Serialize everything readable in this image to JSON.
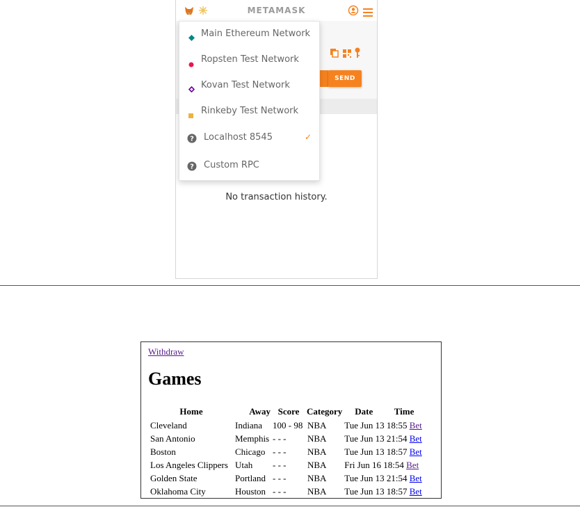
{
  "metamask": {
    "title": "METAMASK",
    "colors": {
      "accent": "#f6821f",
      "title": "#9b9b9b"
    },
    "send_label": "SEND",
    "empty_history": "No transaction history.",
    "networks": [
      {
        "label": "Main Ethereum Network",
        "icon": "diamond-icon",
        "color": "#038789",
        "selected": false
      },
      {
        "label": "Ropsten Test Network",
        "icon": "dot-icon",
        "color": "#e91550",
        "selected": false
      },
      {
        "label": "Kovan Test Network",
        "icon": "diamond-outline-icon",
        "color": "#690496",
        "selected": false
      },
      {
        "label": "Rinkeby Test Network",
        "icon": "square-icon",
        "color": "#ebb33f",
        "selected": false
      },
      {
        "label": "Localhost 8545",
        "icon": "question-circle-icon",
        "color": "#666666",
        "selected": true
      },
      {
        "label": "Custom RPC",
        "icon": "question-circle-icon",
        "color": "#666666",
        "selected": false
      }
    ],
    "check_mark": "✓"
  },
  "dapp": {
    "withdraw_label": "Withdraw",
    "title": "Games",
    "columns": [
      "Home",
      "Away",
      "Score",
      "Category",
      "Date",
      "Time"
    ],
    "rows": [
      {
        "home": "Cleveland",
        "away": "Indiana",
        "score": "100 - 98",
        "category": "NBA",
        "date": "Tue Jun 13",
        "time": "18:55",
        "action": "Bet"
      },
      {
        "home": "San Antonio",
        "away": "Memphis",
        "score": "- - -",
        "category": "NBA",
        "date": "Tue Jun 13",
        "time": "21:54",
        "action": "Bet"
      },
      {
        "home": "Boston",
        "away": "Chicago",
        "score": "- - -",
        "category": "NBA",
        "date": "Tue Jun 13",
        "time": "18:57",
        "action": "Bet"
      },
      {
        "home": "Los Angeles Clippers",
        "away": "Utah",
        "score": "- - -",
        "category": "NBA",
        "date": "Fri Jun 16",
        "time": "18:54",
        "action": "Bet"
      },
      {
        "home": "Golden State",
        "away": "Portland",
        "score": "- - -",
        "category": "NBA",
        "date": "Tue Jun 13",
        "time": "21:54",
        "action": "Bet"
      },
      {
        "home": "Oklahoma City",
        "away": "Houston",
        "score": "- - -",
        "category": "NBA",
        "date": "Tue Jun 13",
        "time": "18:57",
        "action": "Bet"
      }
    ]
  }
}
